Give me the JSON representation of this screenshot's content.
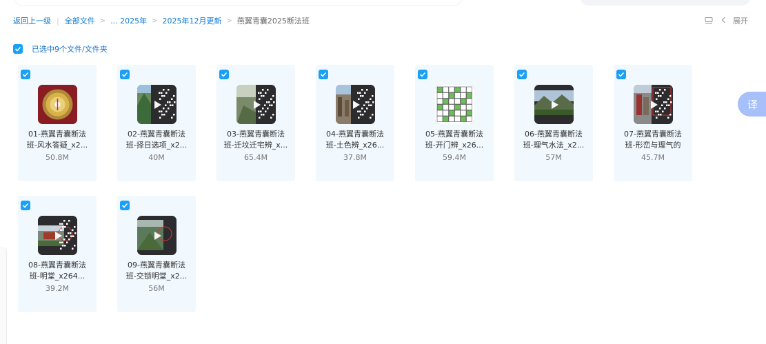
{
  "breadcrumb": {
    "back": "返回上一级",
    "all_files": "全部文件",
    "ellipsis_year": "... 2025年",
    "month": "2025年12月更新",
    "current": "燕翼青囊2025断法班"
  },
  "toolbar": {
    "expand_label": "展开",
    "list_view_icon": "list-view-icon"
  },
  "selection": {
    "label": "已选中9个文件/文件夹",
    "checked": true
  },
  "translate": {
    "label": "译"
  },
  "colors": {
    "accent": "#1aa0f6",
    "link": "#0d7bd3",
    "card_bg": "#f1f8fe",
    "translate_bg": "#a7c0f9"
  },
  "files": [
    {
      "line1": "01-燕翼青囊断法",
      "line2": "班-风水答疑_x2...",
      "size": "50.8M",
      "thumb": "compass"
    },
    {
      "line1": "02-燕翼青囊断法",
      "line2": "班-择日选项_x2...",
      "size": "40M",
      "thumb": "mountain-video"
    },
    {
      "line1": "03-燕翼青囊断法",
      "line2": "班-迁坟迁宅辨_x...",
      "size": "65.4M",
      "thumb": "grave-video"
    },
    {
      "line1": "04-燕翼青囊断法",
      "line2": "班-土色辨_x26...",
      "size": "37.8M",
      "thumb": "street-video"
    },
    {
      "line1": "05-燕翼青囊断法",
      "line2": "班-开门辨_x26...",
      "size": "59.4M",
      "thumb": "grid-chart"
    },
    {
      "line1": "06-燕翼青囊断法",
      "line2": "班-理气水法_x2...",
      "size": "57M",
      "thumb": "landscape-video"
    },
    {
      "line1": "07-燕翼青囊断法",
      "line2": "班-形峦与理气的",
      "size": "45.7M",
      "thumb": "building-video"
    },
    {
      "line1": "08-燕翼青囊断法",
      "line2": "班-明堂_x264...",
      "size": "39.2M",
      "thumb": "hall-video"
    },
    {
      "line1": "09-燕翼青囊断法",
      "line2": "班-交锁明堂_x2...",
      "size": "56M",
      "thumb": "field-video"
    }
  ]
}
